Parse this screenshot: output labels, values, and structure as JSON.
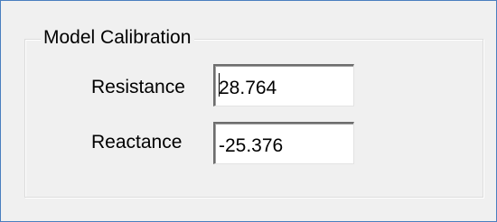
{
  "group": {
    "title": "Model Calibration"
  },
  "fields": {
    "resistance": {
      "label": "Resistance",
      "value": "28.764"
    },
    "reactance": {
      "label": "Reactance",
      "value": "-25.376"
    }
  }
}
